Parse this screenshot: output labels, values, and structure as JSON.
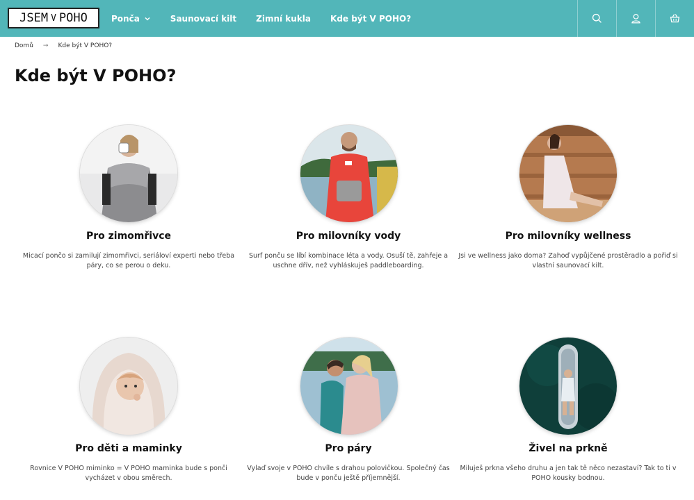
{
  "logo": {
    "left": "JSEM",
    "mid": "V",
    "right": "POHO"
  },
  "nav": {
    "items": [
      {
        "label": "Ponča",
        "has_dropdown": true
      },
      {
        "label": "Saunovací kilt"
      },
      {
        "label": "Zimní kukla"
      },
      {
        "label": "Kde být V POHO?"
      }
    ]
  },
  "header_icons": [
    "search-icon",
    "user-icon",
    "basket-icon"
  ],
  "breadcrumb": {
    "home": "Domů",
    "current": "Kde být V POHO?"
  },
  "page": {
    "title": "Kde být V POHO?"
  },
  "colors": {
    "header": "#52b6b9",
    "text": "#111111"
  },
  "cards": [
    {
      "title": "Pro zimomřivce",
      "desc": "Micací pončo si zamilují zimomřivci, seriáloví experti nebo třeba páry, co se perou o deku."
    },
    {
      "title": "Pro milovníky vody",
      "desc": "Surf ponču se líbí kombinace léta a vody. Osuší tě, zahřeje a uschne dřív, než vyhláskuješ paddleboarding."
    },
    {
      "title": "Pro milovníky wellness",
      "desc": "Jsi ve wellness jako doma? Zahoď vypůjčené prostěradlo a pořiď si vlastní saunovací kilt."
    },
    {
      "title": "Pro děti a maminky",
      "desc": "Rovnice V POHO miminko = V POHO maminka bude s ponči vycházet v obou směrech."
    },
    {
      "title": "Pro páry",
      "desc": "Vylaď svoje v POHO chvíle s drahou polovičkou. Společný čas bude v ponču ještě příjemnější."
    },
    {
      "title": "Živel na prkně",
      "desc": "Miluješ prkna všeho druhu a jen tak tě něco nezastaví? Tak to ti v POHO kousky bodnou."
    }
  ]
}
